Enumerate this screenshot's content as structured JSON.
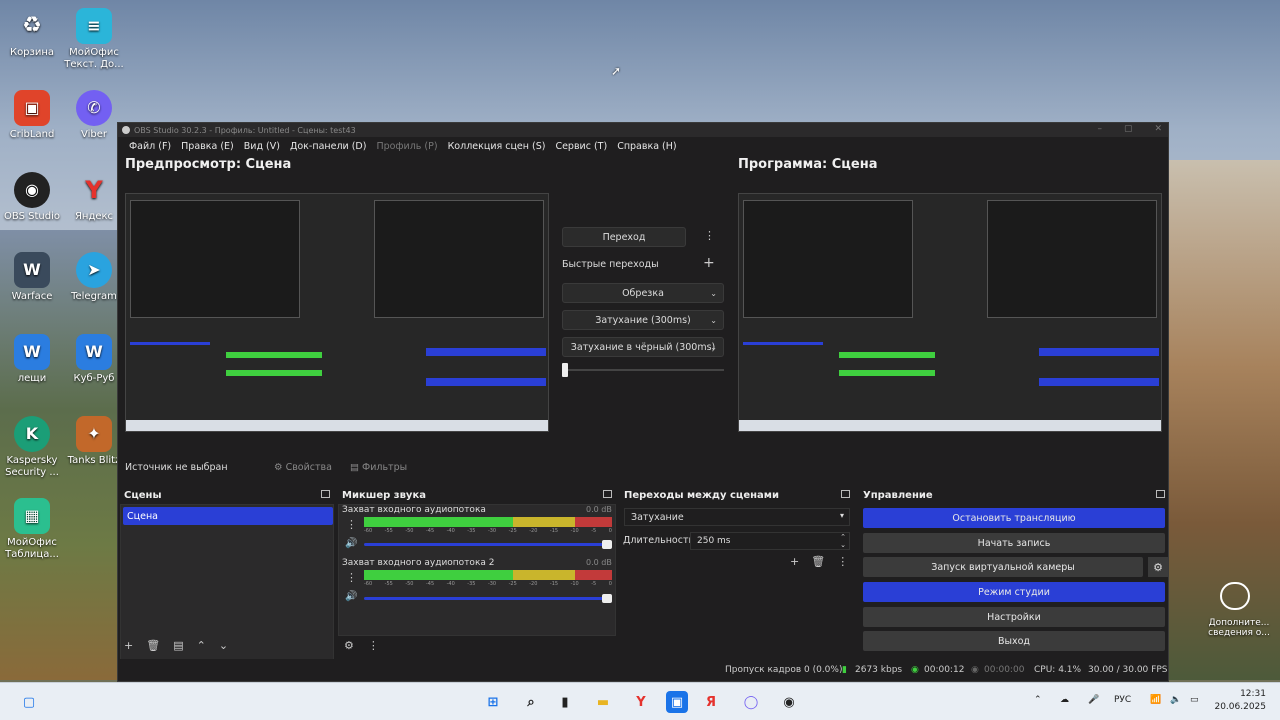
{
  "desktop": {
    "icons_left": [
      {
        "label": "Корзина",
        "icon": "recycle-bin-icon"
      },
      {
        "label": "CribLand",
        "icon": "cribland-icon"
      },
      {
        "label": "OBS Studio",
        "icon": "obs-icon"
      },
      {
        "label": "Warface",
        "icon": "warface-icon"
      },
      {
        "label": "лещи",
        "icon": "word-doc-icon"
      },
      {
        "label": "Kaspersky Security ...",
        "icon": "kaspersky-icon"
      },
      {
        "label": "МойОфис Таблица...",
        "icon": "myoffice-table-icon"
      }
    ],
    "icons_right": [
      {
        "label": "МойОфис Текст. До...",
        "icon": "myoffice-text-icon"
      },
      {
        "label": "Viber",
        "icon": "viber-icon"
      },
      {
        "label": "Яндекс",
        "icon": "yandex-icon"
      },
      {
        "label": "Telegram",
        "icon": "telegram-icon"
      },
      {
        "label": "Куб-Руб",
        "icon": "word-doc-icon"
      },
      {
        "label": "Tanks Blitz",
        "icon": "tanks-blitz-icon"
      }
    ],
    "side_widget": "Дополните... сведения о..."
  },
  "obs": {
    "title": "OBS Studio 30.2.3 - Профиль: Untitled - Сцены: test43",
    "menu": [
      {
        "label": "Файл (F)",
        "disabled": false
      },
      {
        "label": "Правка (E)",
        "disabled": false
      },
      {
        "label": "Вид (V)",
        "disabled": false
      },
      {
        "label": "Док-панели (D)",
        "disabled": false
      },
      {
        "label": "Профиль (P)",
        "disabled": true
      },
      {
        "label": "Коллекция сцен (S)",
        "disabled": false
      },
      {
        "label": "Сервис (T)",
        "disabled": false
      },
      {
        "label": "Справка (H)",
        "disabled": false
      }
    ],
    "preview_title": "Предпросмотр: Сцена",
    "program_title": "Программа: Сцена",
    "transition": {
      "button": "Переход",
      "quick_label": "Быстрые переходы",
      "options": [
        "Обрезка",
        "Затухание (300ms)",
        "Затухание в чёрный (300ms)"
      ]
    },
    "source_bar": {
      "no_source": "Источник не выбран",
      "properties": "Свойства",
      "filters": "Фильтры"
    },
    "scenes": {
      "title": "Сцены",
      "items": [
        "Сцена"
      ]
    },
    "mixer": {
      "title": "Микшер звука",
      "channels": [
        {
          "name": "Захват входного аудиопотока",
          "db": "0.0 dB"
        },
        {
          "name": "Захват входного аудиопотока 2",
          "db": "0.0 dB"
        }
      ],
      "scale": [
        "-60",
        "-55",
        "-50",
        "-45",
        "-40",
        "-35",
        "-30",
        "-25",
        "-20",
        "-15",
        "-10",
        "-5",
        "0"
      ]
    },
    "transitions_dock": {
      "title": "Переходы между сценами",
      "selected": "Затухание",
      "duration_label": "Длительность",
      "duration_value": "250 ms"
    },
    "controls": {
      "title": "Управление",
      "buttons": [
        {
          "label": "Остановить трансляцию",
          "active": true
        },
        {
          "label": "Начать запись",
          "active": false
        },
        {
          "label": "Запуск виртуальной камеры",
          "active": false
        },
        {
          "label": "Режим студии",
          "active": true
        },
        {
          "label": "Настройки",
          "active": false
        },
        {
          "label": "Выход",
          "active": false
        }
      ]
    },
    "status": {
      "dropped": "Пропуск кадров 0 (0.0%)",
      "bitrate": "2673 kbps",
      "stream_time": "00:00:12",
      "rec_time": "00:00:00",
      "cpu": "CPU: 4.1%",
      "fps": "30.00 / 30.00 FPS"
    }
  },
  "taskbar": {
    "lang": "РУС",
    "time": "12:31",
    "date": "20.06.2025"
  },
  "colors": {
    "accent": "#2a3fd6",
    "meter_green": "#3fcf3f",
    "meter_yellow": "#c9b52c",
    "meter_red": "#c23a3a"
  }
}
